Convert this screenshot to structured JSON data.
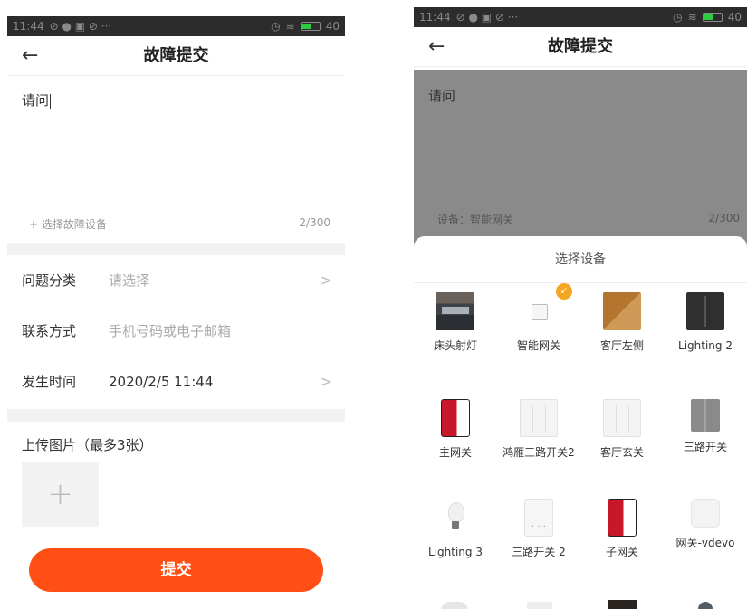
{
  "status_bar": {
    "time": "11:44",
    "battery": "40"
  },
  "left": {
    "title": "故障提交",
    "description_text": "请问",
    "select_device_link": "+ 选择故障设备",
    "char_count": "2/300",
    "rows": [
      {
        "label": "问题分类",
        "value": "请选择",
        "placeholder": true,
        "chevron": ">"
      },
      {
        "label": "联系方式",
        "value": "手机号码或电子邮箱",
        "placeholder": true,
        "chevron": ""
      },
      {
        "label": "发生时间",
        "value": "2020/2/5 11:44",
        "placeholder": false,
        "chevron": ">"
      }
    ],
    "upload_title": "上传图片（最多3张）",
    "upload_plus": "+",
    "submit_label": "提交"
  },
  "right": {
    "title": "故障提交",
    "description_text": "请问",
    "device_line": "设备：智能网关",
    "char_count": "2/300",
    "sheet_title": "选择设备",
    "selected_mark": "✓",
    "devices": [
      {
        "name": "床头射灯",
        "icon": "room-photo-icon",
        "selected": false
      },
      {
        "name": "智能网关",
        "icon": "gateway-icon",
        "selected": true
      },
      {
        "name": "客厅左侧",
        "icon": "dog-photo-icon",
        "selected": false
      },
      {
        "name": "Lighting 2",
        "icon": "dark-switch-icon",
        "selected": false
      },
      {
        "name": "主网关",
        "icon": "red-gateway-icon",
        "selected": false
      },
      {
        "name": "鸿雁三路开关2",
        "icon": "light-panel-icon",
        "selected": false
      },
      {
        "name": "客厅玄关",
        "icon": "light-panel-icon",
        "selected": false
      },
      {
        "name": "三路开关",
        "icon": "grey-panel-icon",
        "selected": false
      },
      {
        "name": "Lighting 3",
        "icon": "bulb-icon",
        "selected": false
      },
      {
        "name": "三路开关 2",
        "icon": "three-switch-icon",
        "selected": false
      },
      {
        "name": "子网关",
        "icon": "red-gateway-icon",
        "selected": false
      },
      {
        "name": "网关-vdevo",
        "icon": "white-square-icon",
        "selected": false
      }
    ]
  }
}
